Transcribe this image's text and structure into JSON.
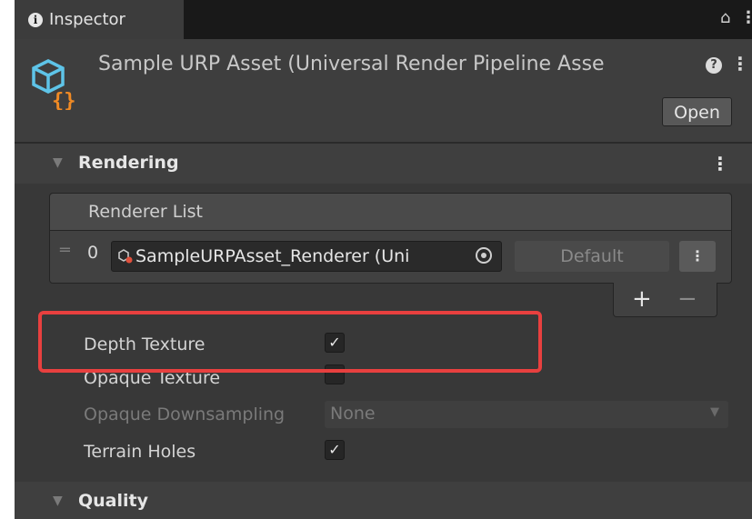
{
  "window": {
    "tab_title": "Inspector",
    "lock_icon": "lock-icon",
    "menu_icon": "kebab-menu-icon"
  },
  "header": {
    "asset_title": "Sample URP Asset (Universal Render Pipeline Asse",
    "asset_icon": "render-pipeline-asset-icon",
    "open_label": "Open"
  },
  "rendering": {
    "section_label": "Rendering",
    "renderer_list": {
      "header": "Renderer List",
      "items": [
        {
          "index": "0",
          "renderer": "SampleURPAsset_Renderer (Uni",
          "default_label": "Default"
        }
      ],
      "add_label": "+",
      "remove_label": "−"
    },
    "properties": {
      "depth_texture": {
        "label": "Depth Texture",
        "checked": true
      },
      "opaque_texture": {
        "label": "Opaque Texture",
        "checked": false
      },
      "opaque_downsampling": {
        "label": "Opaque Downsampling",
        "value": "None",
        "enabled": false
      },
      "terrain_holes": {
        "label": "Terrain Holes",
        "checked": true
      }
    }
  },
  "quality": {
    "section_label": "Quality"
  },
  "colors": {
    "panel_bg": "#383838",
    "highlight": "#e8403f",
    "asset_icon_accent": "#f08a24",
    "asset_icon_main": "#5ec4e8"
  }
}
